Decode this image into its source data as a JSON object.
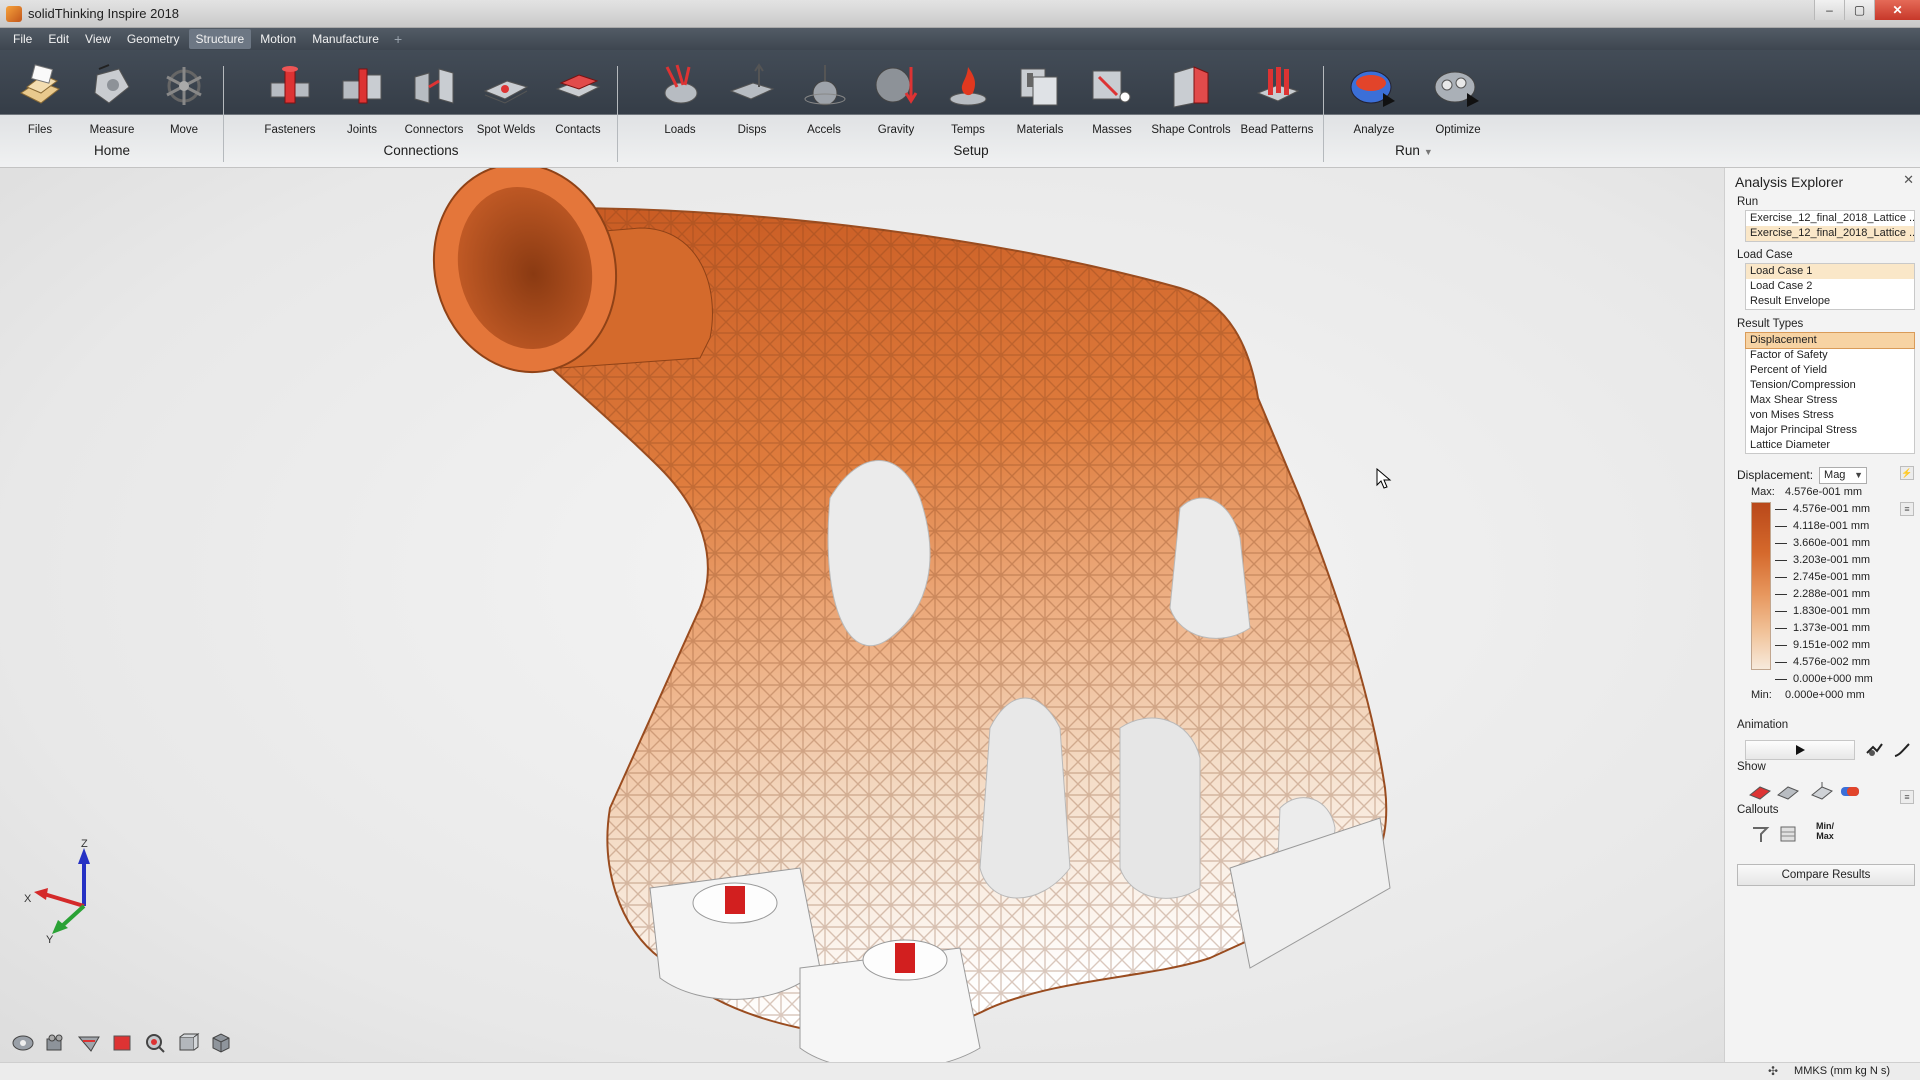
{
  "window": {
    "title": "solidThinking Inspire 2018",
    "controls": [
      "–",
      "▢",
      "✕"
    ]
  },
  "menu": {
    "items": [
      "File",
      "Edit",
      "View",
      "Geometry",
      "Structure",
      "Motion",
      "Manufacture"
    ],
    "active": "Structure",
    "add": "+"
  },
  "ribbon": {
    "groups": [
      {
        "title": "Home",
        "tools": [
          "Files",
          "Measure",
          "Move"
        ]
      },
      {
        "title": "Connections",
        "tools": [
          "Fasteners",
          "Joints",
          "Connectors",
          "Spot Welds",
          "Contacts"
        ]
      },
      {
        "title": "Setup",
        "tools": [
          "Loads",
          "Disps",
          "Accels",
          "Gravity",
          "Temps",
          "Materials",
          "Masses",
          "Shape Controls",
          "Bead Patterns"
        ]
      },
      {
        "title": "Run",
        "tools": [
          "Analyze",
          "Optimize"
        ],
        "dropdown": "▼"
      }
    ]
  },
  "viewport": {
    "axis": {
      "z": "Z",
      "y": "Y",
      "x": "X"
    }
  },
  "explorer": {
    "title": "Analysis Explorer",
    "close": "✕",
    "run_label": "Run",
    "runs": [
      "Exercise_12_final_2018_Lattice ...",
      "Exercise_12_final_2018_Lattice ..."
    ],
    "load_case_label": "Load Case",
    "load_cases": [
      "Load Case 1",
      "Load Case 2",
      "Result Envelope"
    ],
    "result_types_label": "Result Types",
    "result_types": [
      "Displacement",
      "Factor of Safety",
      "Percent of Yield",
      "Tension/Compression",
      "Max Shear Stress",
      "von Mises Stress",
      "Major Principal Stress",
      "Lattice Diameter"
    ],
    "displacement_label": "Displacement:",
    "displacement_mode": "Mag",
    "legend": {
      "max_label": "Max:",
      "max_value": "4.576e-001 mm",
      "min_label": "Min:",
      "min_value": "0.000e+000 mm",
      "values": [
        "4.576e-001 mm",
        "4.118e-001 mm",
        "3.660e-001 mm",
        "3.203e-001 mm",
        "2.745e-001 mm",
        "2.288e-001 mm",
        "1.830e-001 mm",
        "1.373e-001 mm",
        "9.151e-002 mm",
        "4.576e-002 mm",
        "0.000e+000 mm"
      ]
    },
    "animation_label": "Animation",
    "show_label": "Show",
    "callouts_label": "Callouts",
    "minmax_label": "Min/ Max",
    "compare_button": "Compare Results"
  },
  "status": {
    "units": "MMKS (mm kg N s)"
  },
  "colors": {
    "accent": "#d5692c",
    "max": "#b9481a",
    "min": "#f7eadc",
    "selection": "#fae7c8"
  }
}
